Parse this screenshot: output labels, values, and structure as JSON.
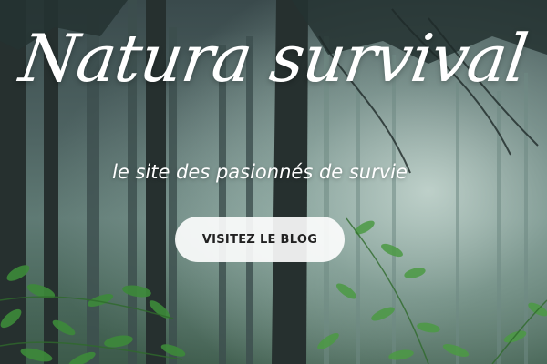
{
  "hero": {
    "title": "Natura survival",
    "subtitle": "le site des pasionnés de survie",
    "cta_label": "VISITEZ LE BLOG"
  },
  "colors": {
    "text": "#ffffff",
    "button_bg": "#ffffff",
    "button_text": "#222222",
    "foliage": "#3f8a3c"
  }
}
